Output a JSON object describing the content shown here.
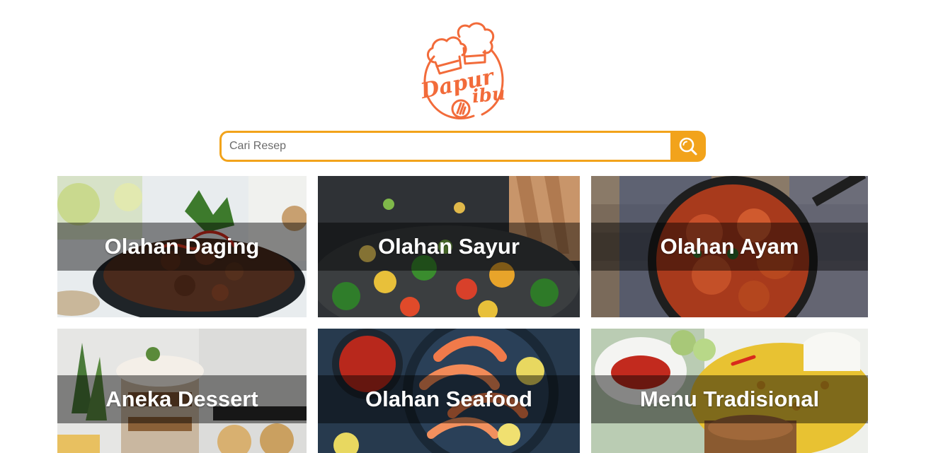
{
  "brand": {
    "logo_text": "Dapur ibu",
    "color": "#f26b3a"
  },
  "search": {
    "placeholder": "Cari Resep",
    "value": "",
    "button_icon": "search-icon",
    "accent": "#f2a31b"
  },
  "categories": [
    {
      "label": "Olahan Daging"
    },
    {
      "label": "Olahan Sayur"
    },
    {
      "label": "Olahan Ayam"
    },
    {
      "label": "Aneka Dessert"
    },
    {
      "label": "Olahan Seafood"
    },
    {
      "label": "Menu Tradisional"
    }
  ]
}
